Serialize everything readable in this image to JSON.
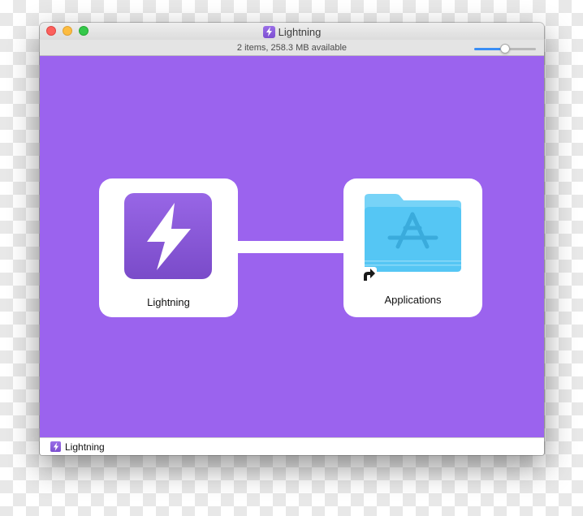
{
  "window": {
    "title": "Lightning",
    "title_icon": "lightning-bolt-icon",
    "status_text": "2 items, 258.3 MB available",
    "icon_size_slider_level": 0.5
  },
  "items": [
    {
      "label": "Lightning",
      "icon": "lightning-app-icon"
    },
    {
      "label": "Applications",
      "icon": "applications-folder-icon",
      "alias_icon": "alias-arrow-icon"
    }
  ],
  "path_bar": {
    "label": "Lightning",
    "icon": "lightning-bolt-icon"
  },
  "colors": {
    "background": "#9b63ee",
    "app_icon": "#8a57dc",
    "folder": "#5ac8f5",
    "slider_accent": "#3a8ef5"
  }
}
